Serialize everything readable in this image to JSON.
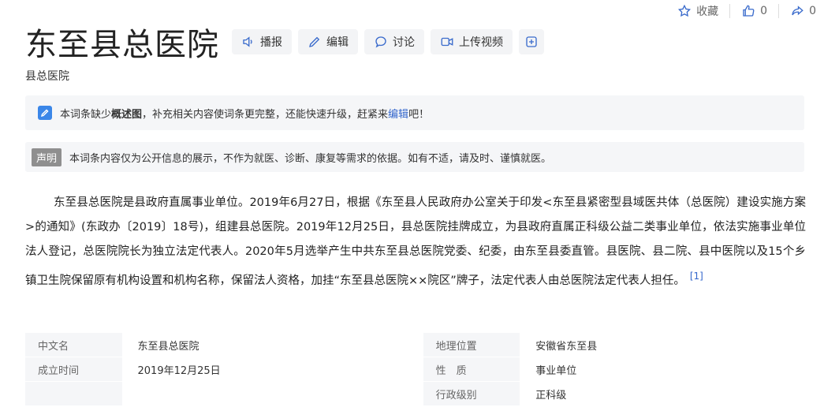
{
  "top": {
    "collect_label": "收藏",
    "like_count": "0",
    "share_count": "0"
  },
  "title": "东至县总医院",
  "actions": {
    "broadcast": "播报",
    "edit": "编辑",
    "discuss": "讨论",
    "upload_video": "上传视频"
  },
  "subtitle": "县总医院",
  "notice1": {
    "prefix": "本词条缺少",
    "bold": "概述图",
    "middle": "，补充相关内容使词条更完整，还能快速升级，赶紧来",
    "link": "编辑",
    "suffix": "吧！"
  },
  "notice2": {
    "tag": "声明",
    "text": "本词条内容仅为公开信息的展示，不作为就医、诊断、康复等需求的依据。如有不适，请及时、谨慎就医。"
  },
  "paragraph": {
    "part1": "东至县总医院是县政府直属事业单位。2019年6月27日，根据《东至县人民政府办公室关于印发<东至县紧密型县域医共体（总医院）建设实施方案>的通知》(东政办〔2019〕18号)，组建县总医院。2019年12月25日，县总医院挂牌成立，为县政府直属正科级公益二类事业单位，依法实施事业单位法人登记，总医院院长为独立法定代表人。2020年5月选举产生中共东至县总医院党委、纪委，由东至县委直管。",
    "underlined": "县医院、县二院、县中医院以及15个乡镇卫生院保留原有机构设置和机构名称，保留法人资格，加挂“东至县总医院××院区”牌子",
    "part2": "，法定代表人由总医院法定代表人担任。",
    "ref": "[1]"
  },
  "info": {
    "rows": [
      {
        "k1": "中文名",
        "v1": "东至县总医院",
        "k2": "地理位置",
        "v2": "安徽省东至县"
      },
      {
        "k1": "成立时间",
        "v1": "2019年12月25日",
        "k2": "性　质",
        "v2": "事业单位"
      },
      {
        "k1": "",
        "v1": "",
        "k2": "行政级别",
        "v2": "正科级"
      }
    ]
  }
}
